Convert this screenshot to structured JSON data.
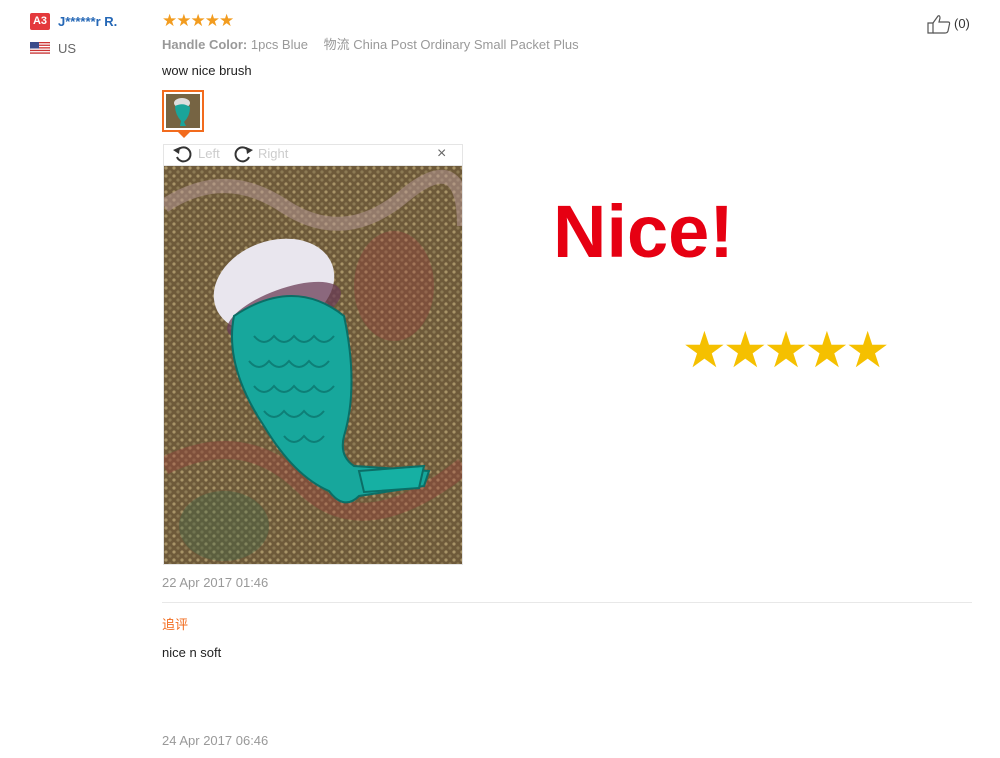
{
  "user": {
    "level_badge": "A3",
    "name": "J******r R.",
    "country": "US",
    "flag": "us-flag-icon"
  },
  "review": {
    "rating_stars": "★★★★★",
    "rating": 5,
    "helpful_count": "(0)",
    "attribute_label": "Handle Color:",
    "attribute_value": "1pcs Blue",
    "shipping_label": "物流",
    "shipping_value": "China Post Ordinary Small Packet Plus",
    "text": "wow nice brush",
    "date": "22 Apr 2017 01:46"
  },
  "viewer": {
    "rotate_left_label": "Left",
    "rotate_right_label": "Right",
    "close_symbol": "×"
  },
  "overlay": {
    "headline": "Nice!",
    "stars": "★★★★★"
  },
  "followup": {
    "label": "追评",
    "text": "nice n soft",
    "date": "24 Apr 2017 06:46"
  },
  "colors": {
    "accent_orange": "#f26b1d",
    "star_orange": "#f29c1f",
    "username_blue": "#2467b6",
    "nice_red": "#e60012",
    "big_star_yellow": "#f5c000"
  }
}
